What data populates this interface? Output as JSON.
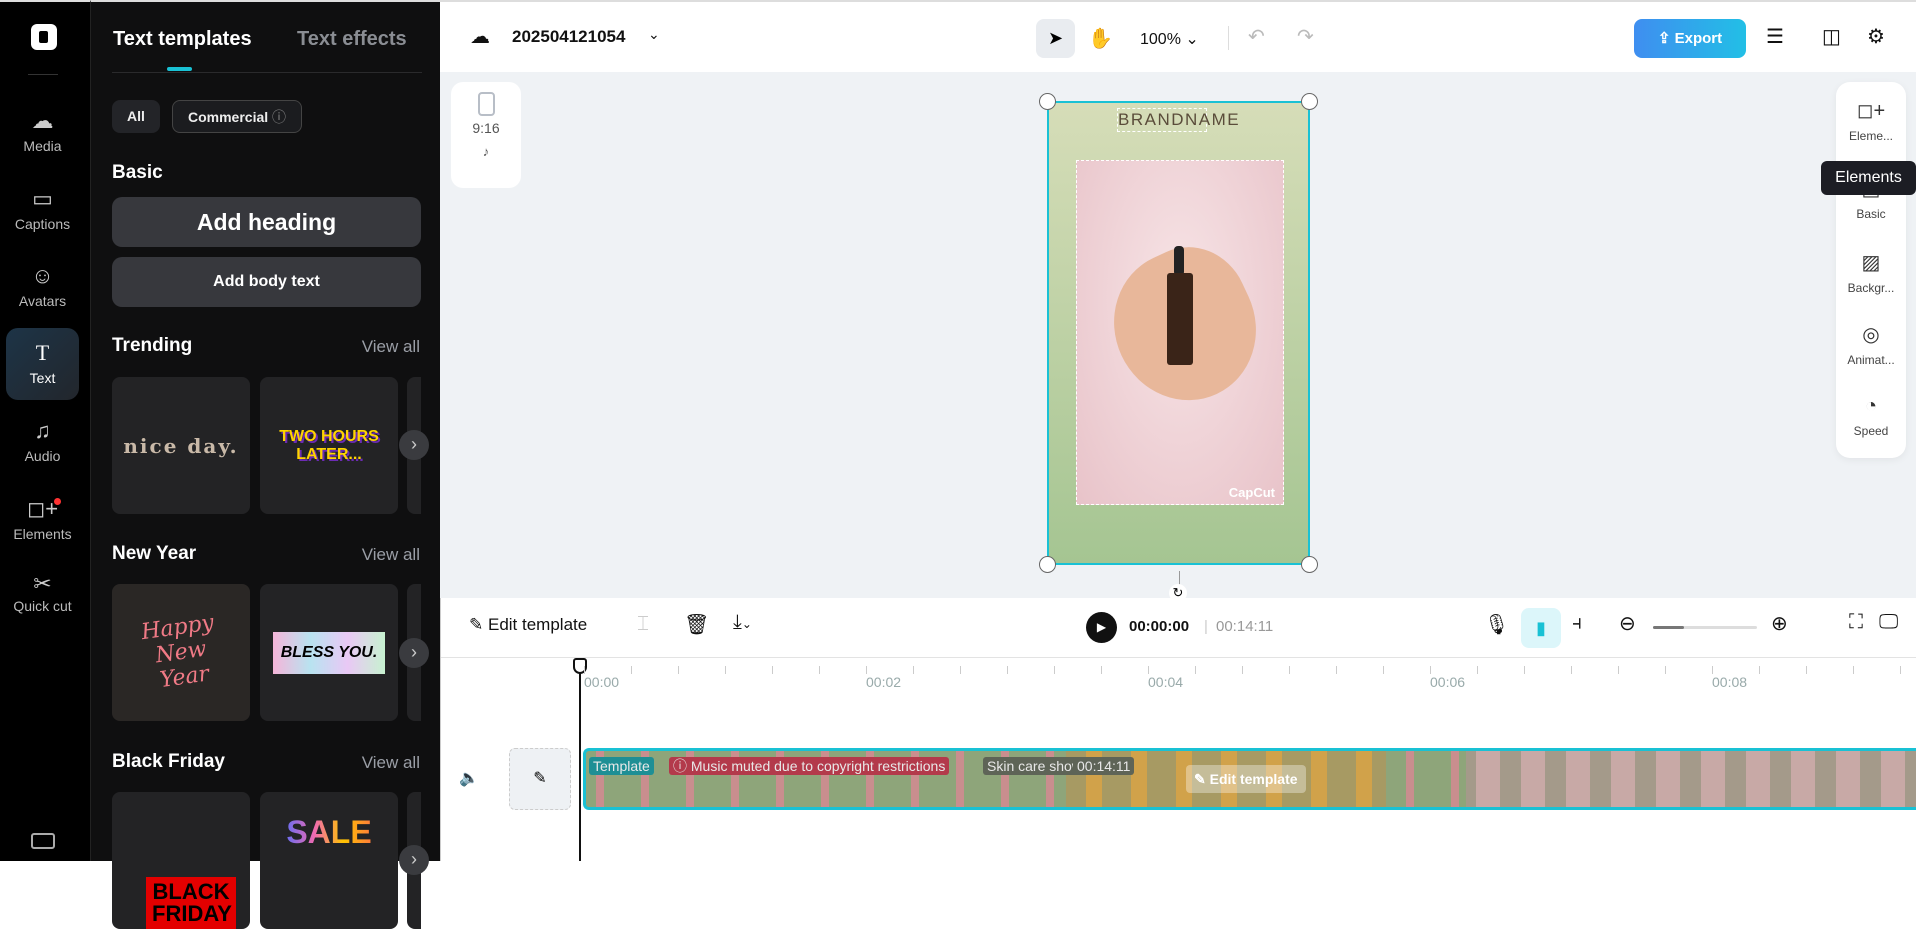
{
  "rail": {
    "items": [
      {
        "label": "Media",
        "icon": "cloud-upload-icon"
      },
      {
        "label": "Captions",
        "icon": "captions-icon"
      },
      {
        "label": "Avatars",
        "icon": "avatar-icon"
      },
      {
        "label": "Text",
        "icon": "text-icon"
      },
      {
        "label": "Audio",
        "icon": "music-icon"
      },
      {
        "label": "Elements",
        "icon": "elements-icon"
      },
      {
        "label": "Quick cut",
        "icon": "scissors-icon"
      }
    ]
  },
  "panel": {
    "tabs": [
      "Text templates",
      "Text effects"
    ],
    "filters": [
      "All",
      "Commercial"
    ],
    "basic": {
      "title": "Basic",
      "add_heading": "Add heading",
      "add_body": "Add body text"
    },
    "view_all": "View all",
    "sections": [
      {
        "title": "Trending",
        "cards": [
          "nice day.",
          "TWO HOURS LATER..."
        ]
      },
      {
        "title": "New Year",
        "cards": [
          "Happy New Year",
          "BLESS YOU."
        ]
      },
      {
        "title": "Black Friday",
        "cards": [
          "BLACK FRIDAY",
          "SALE"
        ]
      }
    ]
  },
  "top": {
    "project_name": "202504121054",
    "zoom": "100%",
    "export": "Export"
  },
  "stage": {
    "ratio": "9:16",
    "brandname": "BRANDNAME",
    "watermark": "CapCut"
  },
  "right_panel": {
    "items": [
      "Eleme...",
      "Basic",
      "Backgr...",
      "Animat...",
      "Speed"
    ],
    "tooltip": "Elements"
  },
  "timeline": {
    "edit_template": "Edit template",
    "current_time": "00:00:00",
    "total_time": "00:14:11",
    "ruler": [
      "00:00",
      "00:02",
      "00:04",
      "00:06",
      "00:08"
    ],
    "track": {
      "tag": "Template",
      "warning": "Music muted due to copyright restrictions",
      "name": "Skin care show",
      "duration": "00:14:11",
      "overlay": "Edit template"
    },
    "zoom_level": 0.3
  },
  "colors": {
    "accent": "#19c1d4",
    "export_start": "#3f8ef0",
    "export_end": "#22bfe6"
  }
}
